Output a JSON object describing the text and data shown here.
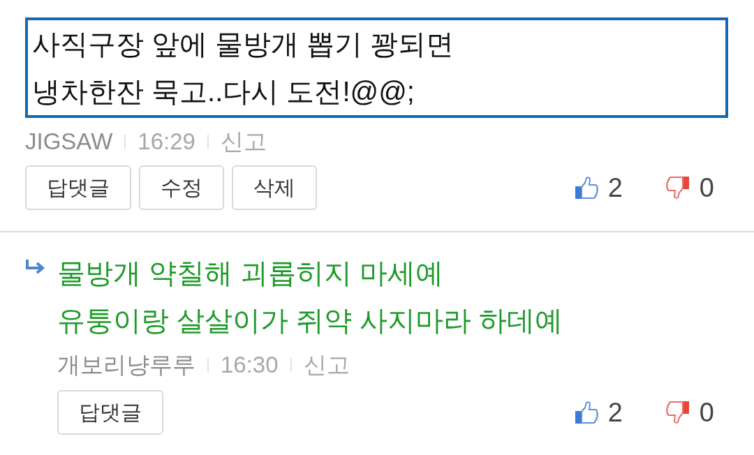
{
  "comments": [
    {
      "kind": "comment",
      "highlighted": true,
      "text": "사직구장 앞에 물방개 뽑기 꽝되면\n냉차한잔 묵고..다시 도전!@@;",
      "author": "JIGSAW",
      "time": "16:29",
      "report": "신고",
      "buttons": [
        "답댓글",
        "수정",
        "삭제"
      ],
      "likes": "2",
      "dislikes": "0"
    },
    {
      "kind": "reply",
      "highlighted": false,
      "text": "물방개 약칠해 괴롭히지 마세예\n유퉁이랑 살살이가 쥐약 사지마라 하데예",
      "author": "개보리냥루루",
      "time": "16:30",
      "report": "신고",
      "buttons": [
        "답댓글"
      ],
      "likes": "2",
      "dislikes": "0"
    }
  ]
}
